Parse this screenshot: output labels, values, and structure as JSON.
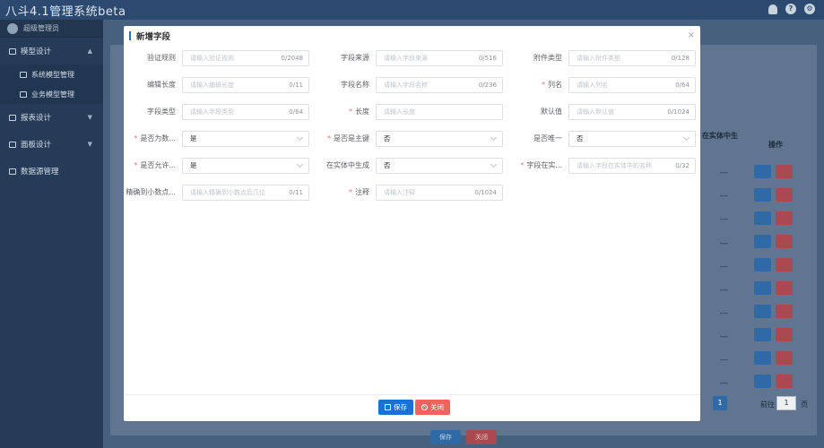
{
  "app": {
    "title": "八斗4.1管理系统beta"
  },
  "header_icons": [
    "bell-icon",
    "help-icon",
    "settings-icon"
  ],
  "sidebar": {
    "user": "超级管理员",
    "groups": [
      {
        "label": "模型设计",
        "caret": "▲"
      },
      {
        "label": "报表设计",
        "caret": "▼"
      },
      {
        "label": "面板设计",
        "caret": "▼"
      },
      {
        "label": "数据源管理",
        "caret": ""
      }
    ],
    "subitems": [
      "系统模型管理",
      "业务模型管理"
    ]
  },
  "background": {
    "column_entity": "在实体中生",
    "column_operation": "操作",
    "row_dash": "---",
    "save": "保存",
    "close": "关闭",
    "page": "1",
    "goto": "前往",
    "goto_value": "1",
    "goto_tail": "页"
  },
  "modal": {
    "title": "新增字段",
    "close_icon": "×",
    "fields": {
      "verify_rule": {
        "label": "验证规则",
        "required": false,
        "placeholder": "请输入验证规则",
        "count": "0/2048"
      },
      "field_source": {
        "label": "字段来源",
        "required": false,
        "placeholder": "请输入字段来源",
        "count": "0/516"
      },
      "attach_type": {
        "label": "附件类型",
        "required": false,
        "placeholder": "请输入附件类型",
        "count": "0/128"
      },
      "edit_length": {
        "label": "编辑长度",
        "required": false,
        "placeholder": "请输入编辑长度",
        "count": "0/11"
      },
      "field_name": {
        "label": "字段名称",
        "required": false,
        "placeholder": "请输入字段名称",
        "count": "0/236"
      },
      "column_name": {
        "label": "列名",
        "required": true,
        "placeholder": "请输入列名",
        "count": "0/64"
      },
      "field_type": {
        "label": "字段类型",
        "required": false,
        "placeholder": "请输入字段类型",
        "count": "0/64"
      },
      "length": {
        "label": "长度",
        "required": true,
        "placeholder": "请输入长度",
        "count": ""
      },
      "default_value": {
        "label": "默认值",
        "required": false,
        "placeholder": "请输入默认值",
        "count": "0/1024"
      },
      "is_numeric": {
        "label": "是否为数...",
        "required": true,
        "value": "是"
      },
      "is_primary": {
        "label": "是否是主键",
        "required": true,
        "value": "否"
      },
      "is_unique": {
        "label": "是否唯一",
        "required": false,
        "value": "否"
      },
      "allow_null": {
        "label": "是否允许...",
        "required": true,
        "value": "是"
      },
      "entity_generate": {
        "label": "在实体中生成",
        "required": false,
        "value": "否"
      },
      "entity_name": {
        "label": "字段在实...",
        "required": true,
        "placeholder": "请输入字段在实体中的名称",
        "count": "0/32"
      },
      "decimal_precision": {
        "label": "精确到小数点...",
        "required": false,
        "placeholder": "请输入精确到小数点后几位",
        "count": "0/11"
      },
      "remark": {
        "label": "注释",
        "required": true,
        "placeholder": "请输入注释",
        "count": "0/1024"
      }
    },
    "save": "保存",
    "close": "关闭"
  }
}
